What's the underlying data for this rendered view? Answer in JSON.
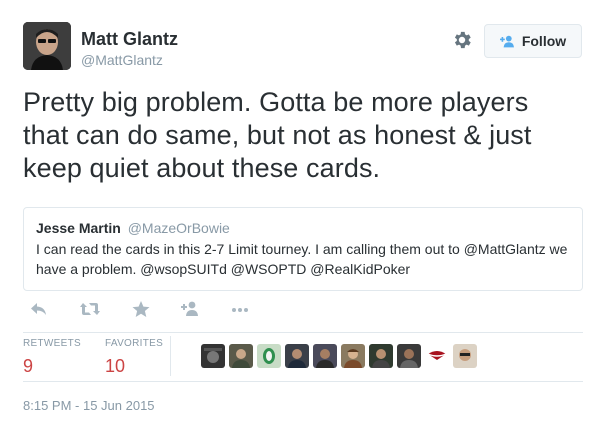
{
  "author": {
    "full_name": "Matt Glantz",
    "screen_name": "@MattGlantz"
  },
  "header": {
    "follow_label": "Follow"
  },
  "tweet": {
    "text": "Pretty big problem. Gotta be more players that can do same, but not as honest & just keep quiet about these cards."
  },
  "quoted_tweet": {
    "full_name": "Jesse Martin",
    "screen_name": "@MazeOrBowie",
    "text": "I can read the cards in this 2-7 Limit tourney. I am calling them out to @MattGlantz we have a problem. @wsopSUITd @WSOPTD @RealKidPoker"
  },
  "actions": [
    "reply-icon",
    "retweet-icon",
    "favorite-icon",
    "follow-icon",
    "more-icon"
  ],
  "stats": {
    "retweets_label": "RETWEETS",
    "retweets_count": "9",
    "favorites_label": "FAVORITES",
    "favorites_count": "10"
  },
  "favoriters_count_shown": 10,
  "timestamp": "8:15 PM - 15 Jun 2015",
  "colors": {
    "text": "#292f33",
    "muted": "#8899a6",
    "border": "#e1e8ed",
    "stat_value": "#cc4444",
    "follow_icon": "#55acee"
  }
}
